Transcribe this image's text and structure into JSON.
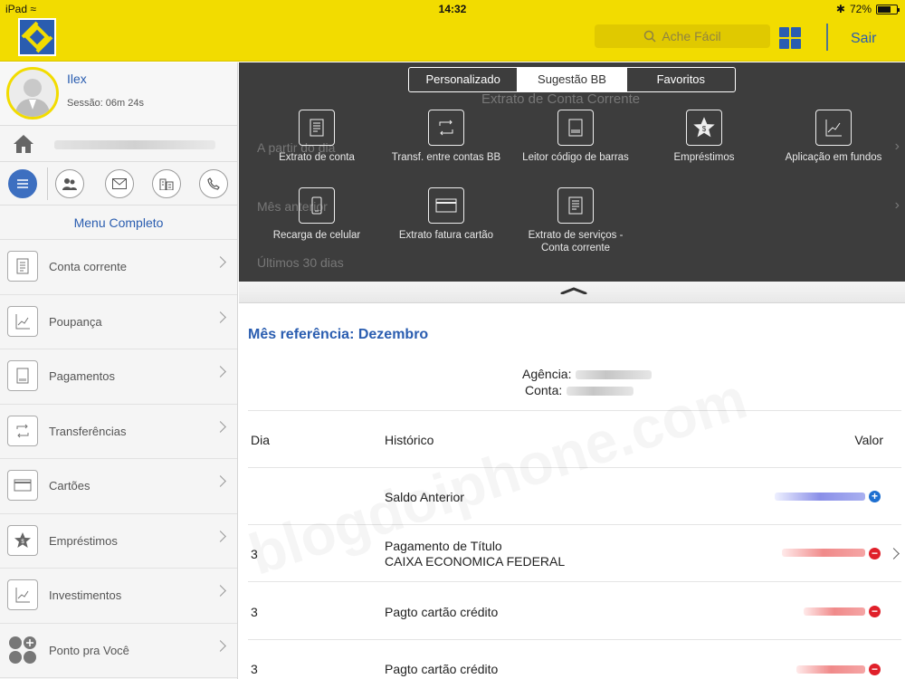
{
  "status": {
    "device": "iPad",
    "time": "14:32",
    "battery": "72%"
  },
  "header": {
    "search_placeholder": "Ache Fácil",
    "logout_label": "Sair"
  },
  "profile": {
    "name": "Ilex",
    "session": "Sessão: 06m 24s"
  },
  "sidebar": {
    "menu_title": "Menu Completo",
    "items": [
      {
        "label": "Conta corrente"
      },
      {
        "label": "Poupança"
      },
      {
        "label": "Pagamentos"
      },
      {
        "label": "Transferências"
      },
      {
        "label": "Cartões"
      },
      {
        "label": "Empréstimos"
      },
      {
        "label": "Investimentos"
      },
      {
        "label": "Ponto pra Você"
      }
    ]
  },
  "overlay": {
    "tabs": [
      {
        "label": "Personalizado"
      },
      {
        "label": "Sugestão BB"
      },
      {
        "label": "Favoritos"
      }
    ],
    "selected_tab": "Sugestão BB",
    "actions": [
      {
        "label": "Extrato de conta"
      },
      {
        "label": "Transf. entre contas BB"
      },
      {
        "label": "Leitor código de barras"
      },
      {
        "label": "Empréstimos"
      },
      {
        "label": "Aplicação em fundos"
      },
      {
        "label": "Recarga de celular"
      },
      {
        "label": "Extrato fatura cartão"
      },
      {
        "label": "Extrato de serviços -\nConta corrente"
      }
    ],
    "ghost": {
      "title": "Extrato de Conta Corrente",
      "opt1": "A partir do dia",
      "opt2": "Mês anterior",
      "opt3": "Últimos 30 dias"
    }
  },
  "statement": {
    "month_ref": "Mês referência: Dezembro",
    "agency_label": "Agência:",
    "account_label": "Conta:",
    "headers": {
      "day": "Dia",
      "history": "Histórico",
      "value": "Valor"
    },
    "rows": [
      {
        "day": "",
        "history": "Saldo Anterior",
        "history2": "",
        "sign": "+"
      },
      {
        "day": "3",
        "history": "Pagamento de Título",
        "history2": "CAIXA ECONOMICA FEDERAL",
        "sign": "−"
      },
      {
        "day": "3",
        "history": "Pagto cartão crédito",
        "history2": "",
        "sign": "−"
      },
      {
        "day": "3",
        "history": "Pagto cartão crédito",
        "history2": "",
        "sign": "−"
      }
    ]
  },
  "colors": {
    "brand_yellow": "#f2dc00",
    "brand_blue": "#2a5db0",
    "credit": "#1e6fd0",
    "debit": "#e0202a"
  },
  "watermark": "blogdoiphone.com"
}
